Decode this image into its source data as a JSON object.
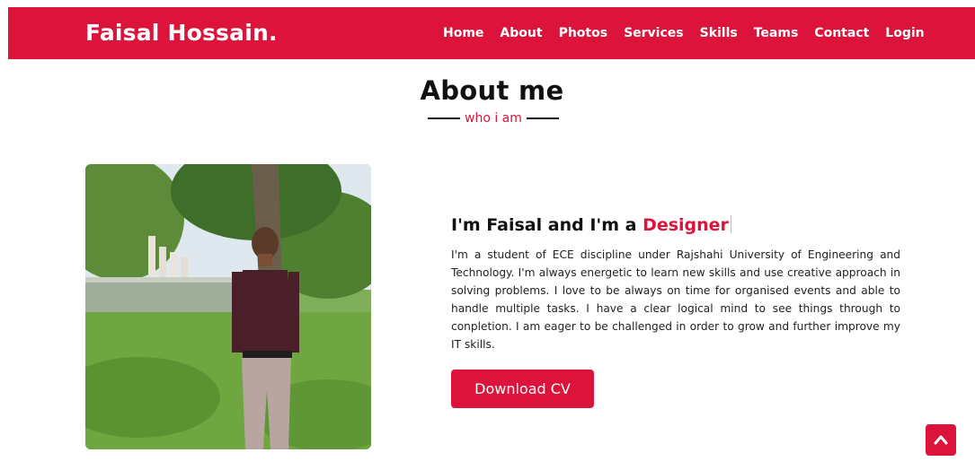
{
  "navbar": {
    "brand": "Faisal Hossain.",
    "links": [
      "Home",
      "About",
      "Photos",
      "Services",
      "Skills",
      "Teams",
      "Contact",
      "Login"
    ]
  },
  "about": {
    "title": "About me",
    "subtitle": "who i am",
    "heading_prefix": "I'm Faisal and I'm a ",
    "heading_accent": "Designer",
    "paragraph": "I'm a student of ECE discipline under Rajshahi University of Engineering and Technology. I'm always energetic to learn new skills and use creative approach in solving problems. I love to be always on time for organised events and able to handle multiple tasks. I have a clear logical mind to see things through to conpletion. I am eager to be challenged in order to grow and further improve my IT skills.",
    "button_label": "Download CV"
  },
  "icons": {
    "scroll_top": "chevron-up-icon",
    "photo": "profile-photo"
  },
  "colors": {
    "accent": "#dc143c",
    "text": "#111111"
  }
}
